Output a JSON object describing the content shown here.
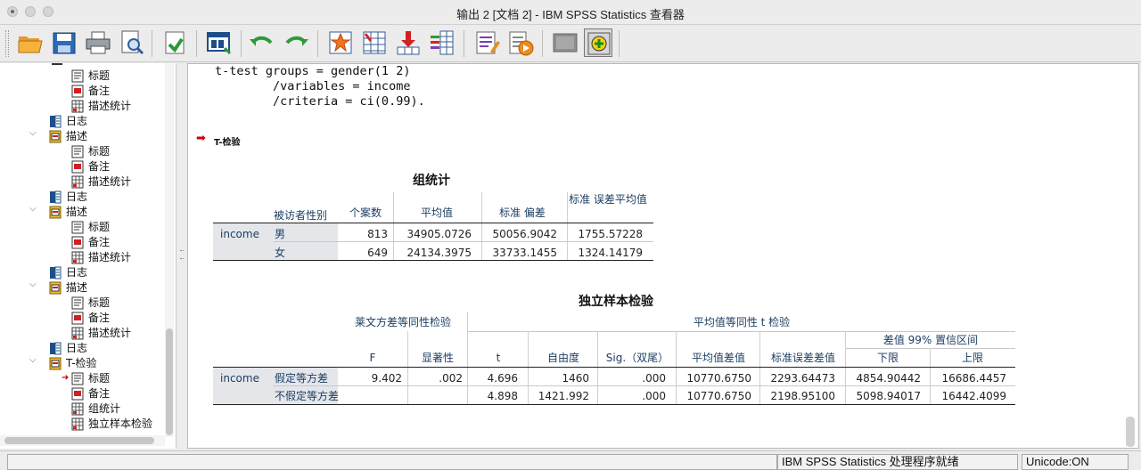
{
  "window": {
    "title": "输出 2 [文档 2] - IBM SPSS Statistics 查看器"
  },
  "toolbar": {
    "buttons": [
      "open-icon",
      "save-icon",
      "print-icon",
      "print-preview-icon",
      "export-icon",
      "recall-dialog-icon",
      "undo-icon",
      "redo-icon",
      "goto-data-icon",
      "goto-case-icon",
      "goto-variable-icon",
      "variables-icon",
      "syntax-icon",
      "run-icon",
      "hide-icon",
      "designate-window-icon"
    ]
  },
  "outline": {
    "nodes": [
      {
        "label": "标题",
        "icon": "title-icon"
      },
      {
        "label": "备注",
        "icon": "notes-icon"
      },
      {
        "label": "描述统计",
        "icon": "table-icon"
      },
      {
        "label": "日志",
        "icon": "log-icon"
      },
      {
        "label": "描述",
        "icon": "procedure-icon"
      },
      {
        "label": "标题",
        "icon": "title-icon"
      },
      {
        "label": "备注",
        "icon": "notes-icon"
      },
      {
        "label": "描述统计",
        "icon": "table-icon"
      },
      {
        "label": "日志",
        "icon": "log-icon"
      },
      {
        "label": "描述",
        "icon": "procedure-icon"
      },
      {
        "label": "标题",
        "icon": "title-icon"
      },
      {
        "label": "备注",
        "icon": "notes-icon"
      },
      {
        "label": "描述统计",
        "icon": "table-icon"
      },
      {
        "label": "日志",
        "icon": "log-icon"
      },
      {
        "label": "描述",
        "icon": "procedure-icon"
      },
      {
        "label": "标题",
        "icon": "title-icon"
      },
      {
        "label": "备注",
        "icon": "notes-icon"
      },
      {
        "label": "描述统计",
        "icon": "table-icon"
      },
      {
        "label": "日志",
        "icon": "log-icon"
      },
      {
        "label": "T-检验",
        "icon": "procedure-icon"
      },
      {
        "label": "标题",
        "icon": "title-icon"
      },
      {
        "label": "备注",
        "icon": "notes-icon"
      },
      {
        "label": "组统计",
        "icon": "table-icon"
      },
      {
        "label": "独立样本检验",
        "icon": "table-icon"
      }
    ]
  },
  "syntax": {
    "line1": "t-test groups = gender(1 2)",
    "line2": "        /variables = income",
    "line3": "        /criteria = ci(0.99)."
  },
  "ttest_heading": "T-检验",
  "group_stats": {
    "title": "组统计",
    "headers": [
      "被访者性别",
      "个案数",
      "平均值",
      "标准 偏差",
      "标准 误差平均值"
    ],
    "variable": "income",
    "rows": [
      {
        "group": "男",
        "n": "813",
        "mean": "34905.0726",
        "sd": "50056.9042",
        "se": "1755.57228"
      },
      {
        "group": "女",
        "n": "649",
        "mean": "24134.3975",
        "sd": "33733.1455",
        "se": "1324.14179"
      }
    ]
  },
  "indep_test": {
    "title": "独立样本检验",
    "levene_header": "莱文方差等同性检验",
    "ttest_header": "平均值等同性 t 检验",
    "ci_header": "差值 99% 置信区间",
    "headers": [
      "F",
      "显著性",
      "t",
      "自由度",
      "Sig.（双尾）",
      "平均值差值",
      "标准误差差值",
      "下限",
      "上限"
    ],
    "variable": "income",
    "rows": [
      {
        "label": "假定等方差",
        "F": "9.402",
        "sig": ".002",
        "t": "4.696",
        "df": "1460",
        "sig2": ".000",
        "md": "10770.6750",
        "sed": "2293.64473",
        "lower": "4854.90442",
        "upper": "16686.4457"
      },
      {
        "label": "不假定等方差",
        "F": "",
        "sig": "",
        "t": "4.898",
        "df": "1421.992",
        "sig2": ".000",
        "md": "10770.6750",
        "sed": "2198.95100",
        "lower": "5098.94017",
        "upper": "16442.4099"
      }
    ]
  },
  "status": {
    "processor": "IBM SPSS Statistics 处理程序就绪",
    "unicode": "Unicode:ON"
  }
}
